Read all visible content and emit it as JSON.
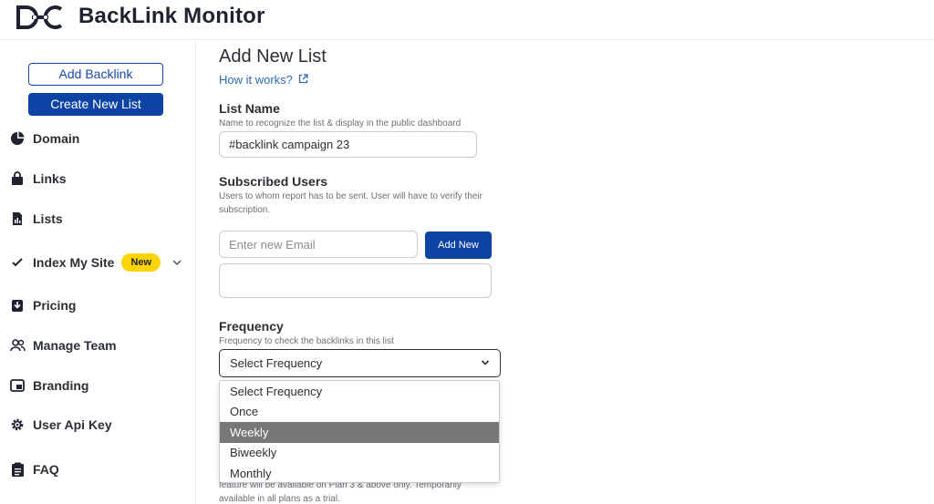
{
  "app": {
    "title": "BackLink Monitor",
    "logo_text": "D-C"
  },
  "sidebar": {
    "add_backlink_label": "Add Backlink",
    "create_list_label": "Create New List",
    "items": [
      {
        "label": "Domain",
        "icon": "pie-chart-icon"
      },
      {
        "label": "Links",
        "icon": "shopping-bag-icon"
      },
      {
        "label": "Lists",
        "icon": "document-chart-icon"
      },
      {
        "label": "Index My Site",
        "icon": "checkmark-icon",
        "badge": "New",
        "has_chevron": true
      },
      {
        "label": "Pricing",
        "icon": "download-tray-icon"
      },
      {
        "label": "Manage Team",
        "icon": "users-icon"
      },
      {
        "label": "Branding",
        "icon": "picture-in-picture-icon"
      },
      {
        "label": "User Api Key",
        "icon": "gear-icon"
      },
      {
        "label": "FAQ",
        "icon": "clipboard-icon"
      }
    ]
  },
  "main": {
    "title": "Add New List",
    "how_it_works": "How it works?",
    "list_name": {
      "label": "List Name",
      "help": "Name to recognize the list & display in the public dashboard",
      "value": "#backlink campaign 23"
    },
    "subscribed_users": {
      "label": "Subscribed Users",
      "help": "Users to whom report has to be sent. User will have to verify their subscription.",
      "email_placeholder": "Enter new Email",
      "add_button": "Add New"
    },
    "frequency": {
      "label": "Frequency",
      "help": "Frequency to check the backlinks in this list",
      "selected": "Select Frequency",
      "options": [
        "Select Frequency",
        "Once",
        "Weekly",
        "Biweekly",
        "Monthly"
      ],
      "highlighted": "Weekly"
    },
    "note": "feature will be available on Plan 3 & above only. Temporarily available in all plans as a trial."
  },
  "colors": {
    "primary": "#0d43a3",
    "badge": "#fcd400",
    "link": "#2e6db4",
    "highlight": "#777777"
  }
}
